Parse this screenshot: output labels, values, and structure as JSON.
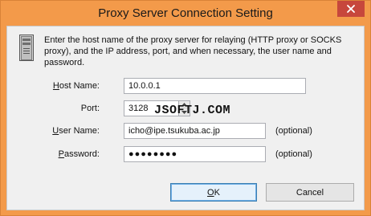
{
  "window": {
    "title": "Proxy Server Connection Setting"
  },
  "description": "Enter the host name of the proxy server for relaying (HTTP proxy or SOCKS proxy), and the IP address, port, and when necessary, the user name and password.",
  "fields": {
    "host_name": {
      "mnemonic": "H",
      "rest": "ost Name:",
      "value": "10.0.0.1"
    },
    "port": {
      "label": "Port:",
      "value": "3128"
    },
    "user_name": {
      "mnemonic": "U",
      "rest": "ser Name:",
      "value": "icho@ipe.tsukuba.ac.jp",
      "hint": "(optional)"
    },
    "password": {
      "mnemonic": "P",
      "rest": "assword:",
      "value": "●●●●●●●●",
      "hint": "(optional)"
    }
  },
  "watermark": "JSOFTJ.COM",
  "buttons": {
    "ok": {
      "mnemonic": "O",
      "rest": "K"
    },
    "cancel": {
      "label": "Cancel"
    }
  },
  "colors": {
    "title_bar": "#f39a4a",
    "close_button": "#c7473c",
    "client_background": "#f0f0f0"
  }
}
